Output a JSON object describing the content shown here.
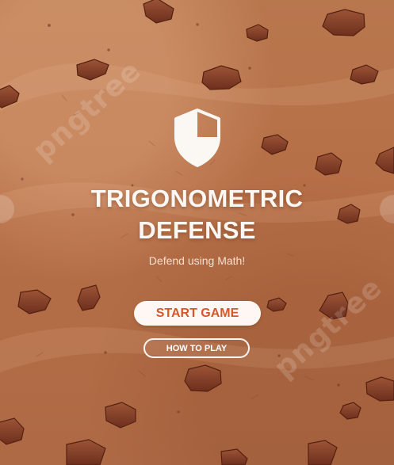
{
  "game": {
    "title_line_1": "TRIGONOMETRIC",
    "title_line_2": "DEFENSE",
    "subtitle": "Defend using Math!",
    "primary_button": "START GAME",
    "secondary_button": "HOW TO PLAY"
  },
  "watermarks": [
    "pngtree",
    "pngtree"
  ],
  "icons": {
    "logo": "shield-icon"
  },
  "colors": {
    "accent": "#d3592a",
    "text_light": "#fbf7f2",
    "background": "#b66f47"
  }
}
